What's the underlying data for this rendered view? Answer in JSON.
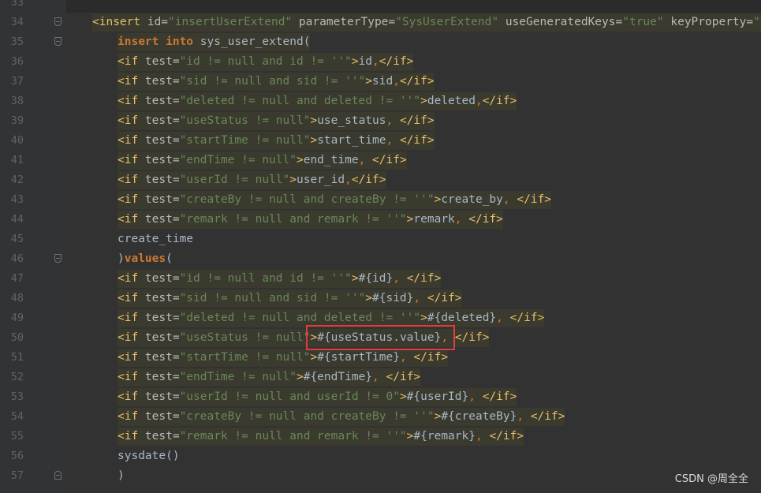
{
  "lines": [
    {
      "num": "33",
      "indent": 0,
      "tokens": []
    },
    {
      "num": "34",
      "indent": 1,
      "fold": "top",
      "tokens": [
        {
          "t": "t",
          "s": "<insert "
        },
        {
          "t": "a",
          "s": "id="
        },
        {
          "t": "v",
          "s": "\"insertUserExtend\""
        },
        {
          "t": "a",
          "s": " parameterType="
        },
        {
          "t": "v",
          "s": "\"SysUserExtend\""
        },
        {
          "t": "a",
          "s": " useGeneratedKeys="
        },
        {
          "t": "v",
          "s": "\"true\""
        },
        {
          "t": "a",
          "s": " keyProperty="
        },
        {
          "t": "v",
          "s": "\"id\""
        },
        {
          "t": "t",
          "s": ">"
        }
      ]
    },
    {
      "num": "35",
      "indent": 2,
      "fold": "top",
      "tokens": [
        {
          "t": "k",
          "s": "insert into "
        },
        {
          "t": "p",
          "s": "sys_user_extend("
        }
      ]
    },
    {
      "num": "36",
      "indent": 2,
      "tokens": [
        {
          "t": "t",
          "s": "<if "
        },
        {
          "t": "a",
          "s": "test="
        },
        {
          "t": "v",
          "s": "\"id != null and id != ''\""
        },
        {
          "t": "t",
          "s": ">"
        },
        {
          "t": "p",
          "s": "id"
        },
        {
          "t": "c",
          "s": ","
        },
        {
          "t": "t",
          "s": "</if>"
        }
      ]
    },
    {
      "num": "37",
      "indent": 2,
      "tokens": [
        {
          "t": "t",
          "s": "<if "
        },
        {
          "t": "a",
          "s": "test="
        },
        {
          "t": "v",
          "s": "\"sid != null and sid != ''\""
        },
        {
          "t": "t",
          "s": ">"
        },
        {
          "t": "p",
          "s": "sid"
        },
        {
          "t": "c",
          "s": ","
        },
        {
          "t": "t",
          "s": "</if>"
        }
      ]
    },
    {
      "num": "38",
      "indent": 2,
      "tokens": [
        {
          "t": "t",
          "s": "<if "
        },
        {
          "t": "a",
          "s": "test="
        },
        {
          "t": "v",
          "s": "\"deleted != null and deleted != ''\""
        },
        {
          "t": "t",
          "s": ">"
        },
        {
          "t": "p",
          "s": "deleted"
        },
        {
          "t": "c",
          "s": ","
        },
        {
          "t": "t",
          "s": "</if>"
        }
      ]
    },
    {
      "num": "39",
      "indent": 2,
      "tokens": [
        {
          "t": "t",
          "s": "<if "
        },
        {
          "t": "a",
          "s": "test="
        },
        {
          "t": "v",
          "s": "\"useStatus != null\""
        },
        {
          "t": "t",
          "s": ">"
        },
        {
          "t": "p",
          "s": "use_status"
        },
        {
          "t": "c",
          "s": ", "
        },
        {
          "t": "t",
          "s": "</if>"
        }
      ]
    },
    {
      "num": "40",
      "indent": 2,
      "tokens": [
        {
          "t": "t",
          "s": "<if "
        },
        {
          "t": "a",
          "s": "test="
        },
        {
          "t": "v",
          "s": "\"startTime != null\""
        },
        {
          "t": "t",
          "s": ">"
        },
        {
          "t": "p",
          "s": "start_time"
        },
        {
          "t": "c",
          "s": ", "
        },
        {
          "t": "t",
          "s": "</if>"
        }
      ]
    },
    {
      "num": "41",
      "indent": 2,
      "tokens": [
        {
          "t": "t",
          "s": "<if "
        },
        {
          "t": "a",
          "s": "test="
        },
        {
          "t": "v",
          "s": "\"endTime != null\""
        },
        {
          "t": "t",
          "s": ">"
        },
        {
          "t": "p",
          "s": "end_time"
        },
        {
          "t": "c",
          "s": ", "
        },
        {
          "t": "t",
          "s": "</if>"
        }
      ]
    },
    {
      "num": "42",
      "indent": 2,
      "tokens": [
        {
          "t": "t",
          "s": "<if "
        },
        {
          "t": "a",
          "s": "test="
        },
        {
          "t": "v",
          "s": "\"userId != null\""
        },
        {
          "t": "t",
          "s": ">"
        },
        {
          "t": "p",
          "s": "user_id"
        },
        {
          "t": "c",
          "s": ","
        },
        {
          "t": "t",
          "s": "</if>"
        }
      ]
    },
    {
      "num": "43",
      "indent": 2,
      "tokens": [
        {
          "t": "t",
          "s": "<if "
        },
        {
          "t": "a",
          "s": "test="
        },
        {
          "t": "v",
          "s": "\"createBy != null and createBy != ''\""
        },
        {
          "t": "t",
          "s": ">"
        },
        {
          "t": "p",
          "s": "create_by"
        },
        {
          "t": "c",
          "s": ", "
        },
        {
          "t": "t",
          "s": "</if>"
        }
      ]
    },
    {
      "num": "44",
      "indent": 2,
      "tokens": [
        {
          "t": "t",
          "s": "<if "
        },
        {
          "t": "a",
          "s": "test="
        },
        {
          "t": "v",
          "s": "\"remark != null and remark != ''\""
        },
        {
          "t": "t",
          "s": ">"
        },
        {
          "t": "p",
          "s": "remark"
        },
        {
          "t": "c",
          "s": ", "
        },
        {
          "t": "t",
          "s": "</if>"
        }
      ]
    },
    {
      "num": "45",
      "indent": 2,
      "plain": true,
      "tokens": [
        {
          "t": "p",
          "s": "create_time"
        }
      ]
    },
    {
      "num": "46",
      "indent": 2,
      "plain": true,
      "fold": "top",
      "tokens": [
        {
          "t": "p",
          "s": ")"
        },
        {
          "t": "k",
          "s": "values"
        },
        {
          "t": "p",
          "s": "("
        }
      ]
    },
    {
      "num": "47",
      "indent": 2,
      "tokens": [
        {
          "t": "t",
          "s": "<if "
        },
        {
          "t": "a",
          "s": "test="
        },
        {
          "t": "v",
          "s": "\"id != null and id != ''\""
        },
        {
          "t": "t",
          "s": ">"
        },
        {
          "t": "p",
          "s": "#{id}"
        },
        {
          "t": "c",
          "s": ", "
        },
        {
          "t": "t",
          "s": "</if>"
        }
      ]
    },
    {
      "num": "48",
      "indent": 2,
      "tokens": [
        {
          "t": "t",
          "s": "<if "
        },
        {
          "t": "a",
          "s": "test="
        },
        {
          "t": "v",
          "s": "\"sid != null and sid != ''\""
        },
        {
          "t": "t",
          "s": ">"
        },
        {
          "t": "p",
          "s": "#{sid}"
        },
        {
          "t": "c",
          "s": ", "
        },
        {
          "t": "t",
          "s": "</if>"
        }
      ]
    },
    {
      "num": "49",
      "indent": 2,
      "tokens": [
        {
          "t": "t",
          "s": "<if "
        },
        {
          "t": "a",
          "s": "test="
        },
        {
          "t": "v",
          "s": "\"deleted != null and deleted != ''\""
        },
        {
          "t": "t",
          "s": ">"
        },
        {
          "t": "p",
          "s": "#{deleted}"
        },
        {
          "t": "c",
          "s": ", "
        },
        {
          "t": "t",
          "s": "</if>"
        }
      ]
    },
    {
      "num": "50",
      "indent": 2,
      "tokens": [
        {
          "t": "t",
          "s": "<if "
        },
        {
          "t": "a",
          "s": "test="
        },
        {
          "t": "v",
          "s": "\"useStatus != null\""
        },
        {
          "t": "t",
          "s": ">"
        },
        {
          "t": "p",
          "s": "#{useStatus.value}"
        },
        {
          "t": "c",
          "s": ", "
        },
        {
          "t": "t",
          "s": "</if>"
        }
      ]
    },
    {
      "num": "51",
      "indent": 2,
      "tokens": [
        {
          "t": "t",
          "s": "<if "
        },
        {
          "t": "a",
          "s": "test="
        },
        {
          "t": "v",
          "s": "\"startTime != null\""
        },
        {
          "t": "t",
          "s": ">"
        },
        {
          "t": "p",
          "s": "#{startTime}"
        },
        {
          "t": "c",
          "s": ", "
        },
        {
          "t": "t",
          "s": "</if>"
        }
      ]
    },
    {
      "num": "52",
      "indent": 2,
      "tokens": [
        {
          "t": "t",
          "s": "<if "
        },
        {
          "t": "a",
          "s": "test="
        },
        {
          "t": "v",
          "s": "\"endTime != null\""
        },
        {
          "t": "t",
          "s": ">"
        },
        {
          "t": "p",
          "s": "#{endTime}"
        },
        {
          "t": "c",
          "s": ", "
        },
        {
          "t": "t",
          "s": "</if>"
        }
      ]
    },
    {
      "num": "53",
      "indent": 2,
      "tokens": [
        {
          "t": "t",
          "s": "<if "
        },
        {
          "t": "a",
          "s": "test="
        },
        {
          "t": "v",
          "s": "\"userId != null and userId != 0\""
        },
        {
          "t": "t",
          "s": ">"
        },
        {
          "t": "p",
          "s": "#{userId}"
        },
        {
          "t": "c",
          "s": ", "
        },
        {
          "t": "t",
          "s": "</if>"
        }
      ]
    },
    {
      "num": "54",
      "indent": 2,
      "tokens": [
        {
          "t": "t",
          "s": "<if "
        },
        {
          "t": "a",
          "s": "test="
        },
        {
          "t": "v",
          "s": "\"createBy != null and createBy != ''\""
        },
        {
          "t": "t",
          "s": ">"
        },
        {
          "t": "p",
          "s": "#{createBy}"
        },
        {
          "t": "c",
          "s": ", "
        },
        {
          "t": "t",
          "s": "</if>"
        }
      ]
    },
    {
      "num": "55",
      "indent": 2,
      "tokens": [
        {
          "t": "t",
          "s": "<if "
        },
        {
          "t": "a",
          "s": "test="
        },
        {
          "t": "v",
          "s": "\"remark != null and remark != ''\""
        },
        {
          "t": "t",
          "s": ">"
        },
        {
          "t": "p",
          "s": "#{remark}"
        },
        {
          "t": "c",
          "s": ", "
        },
        {
          "t": "t",
          "s": "</if>"
        }
      ]
    },
    {
      "num": "56",
      "indent": 2,
      "plain": true,
      "tokens": [
        {
          "t": "p",
          "s": "sysdate()"
        }
      ]
    },
    {
      "num": "57",
      "indent": 2,
      "plain": true,
      "fold": "bot",
      "tokens": [
        {
          "t": "p",
          "s": ")"
        }
      ]
    }
  ],
  "highlight": {
    "line": "50",
    "text": "#{useStatus.value}, "
  },
  "watermark": "CSDN @周全全",
  "colors": {
    "background": "#2b2b2b",
    "gutter": "#313335",
    "tag": "#e8bf6a",
    "string": "#6a8759",
    "keyword": "#cc7832",
    "highlight_box": "#e23b3b"
  }
}
